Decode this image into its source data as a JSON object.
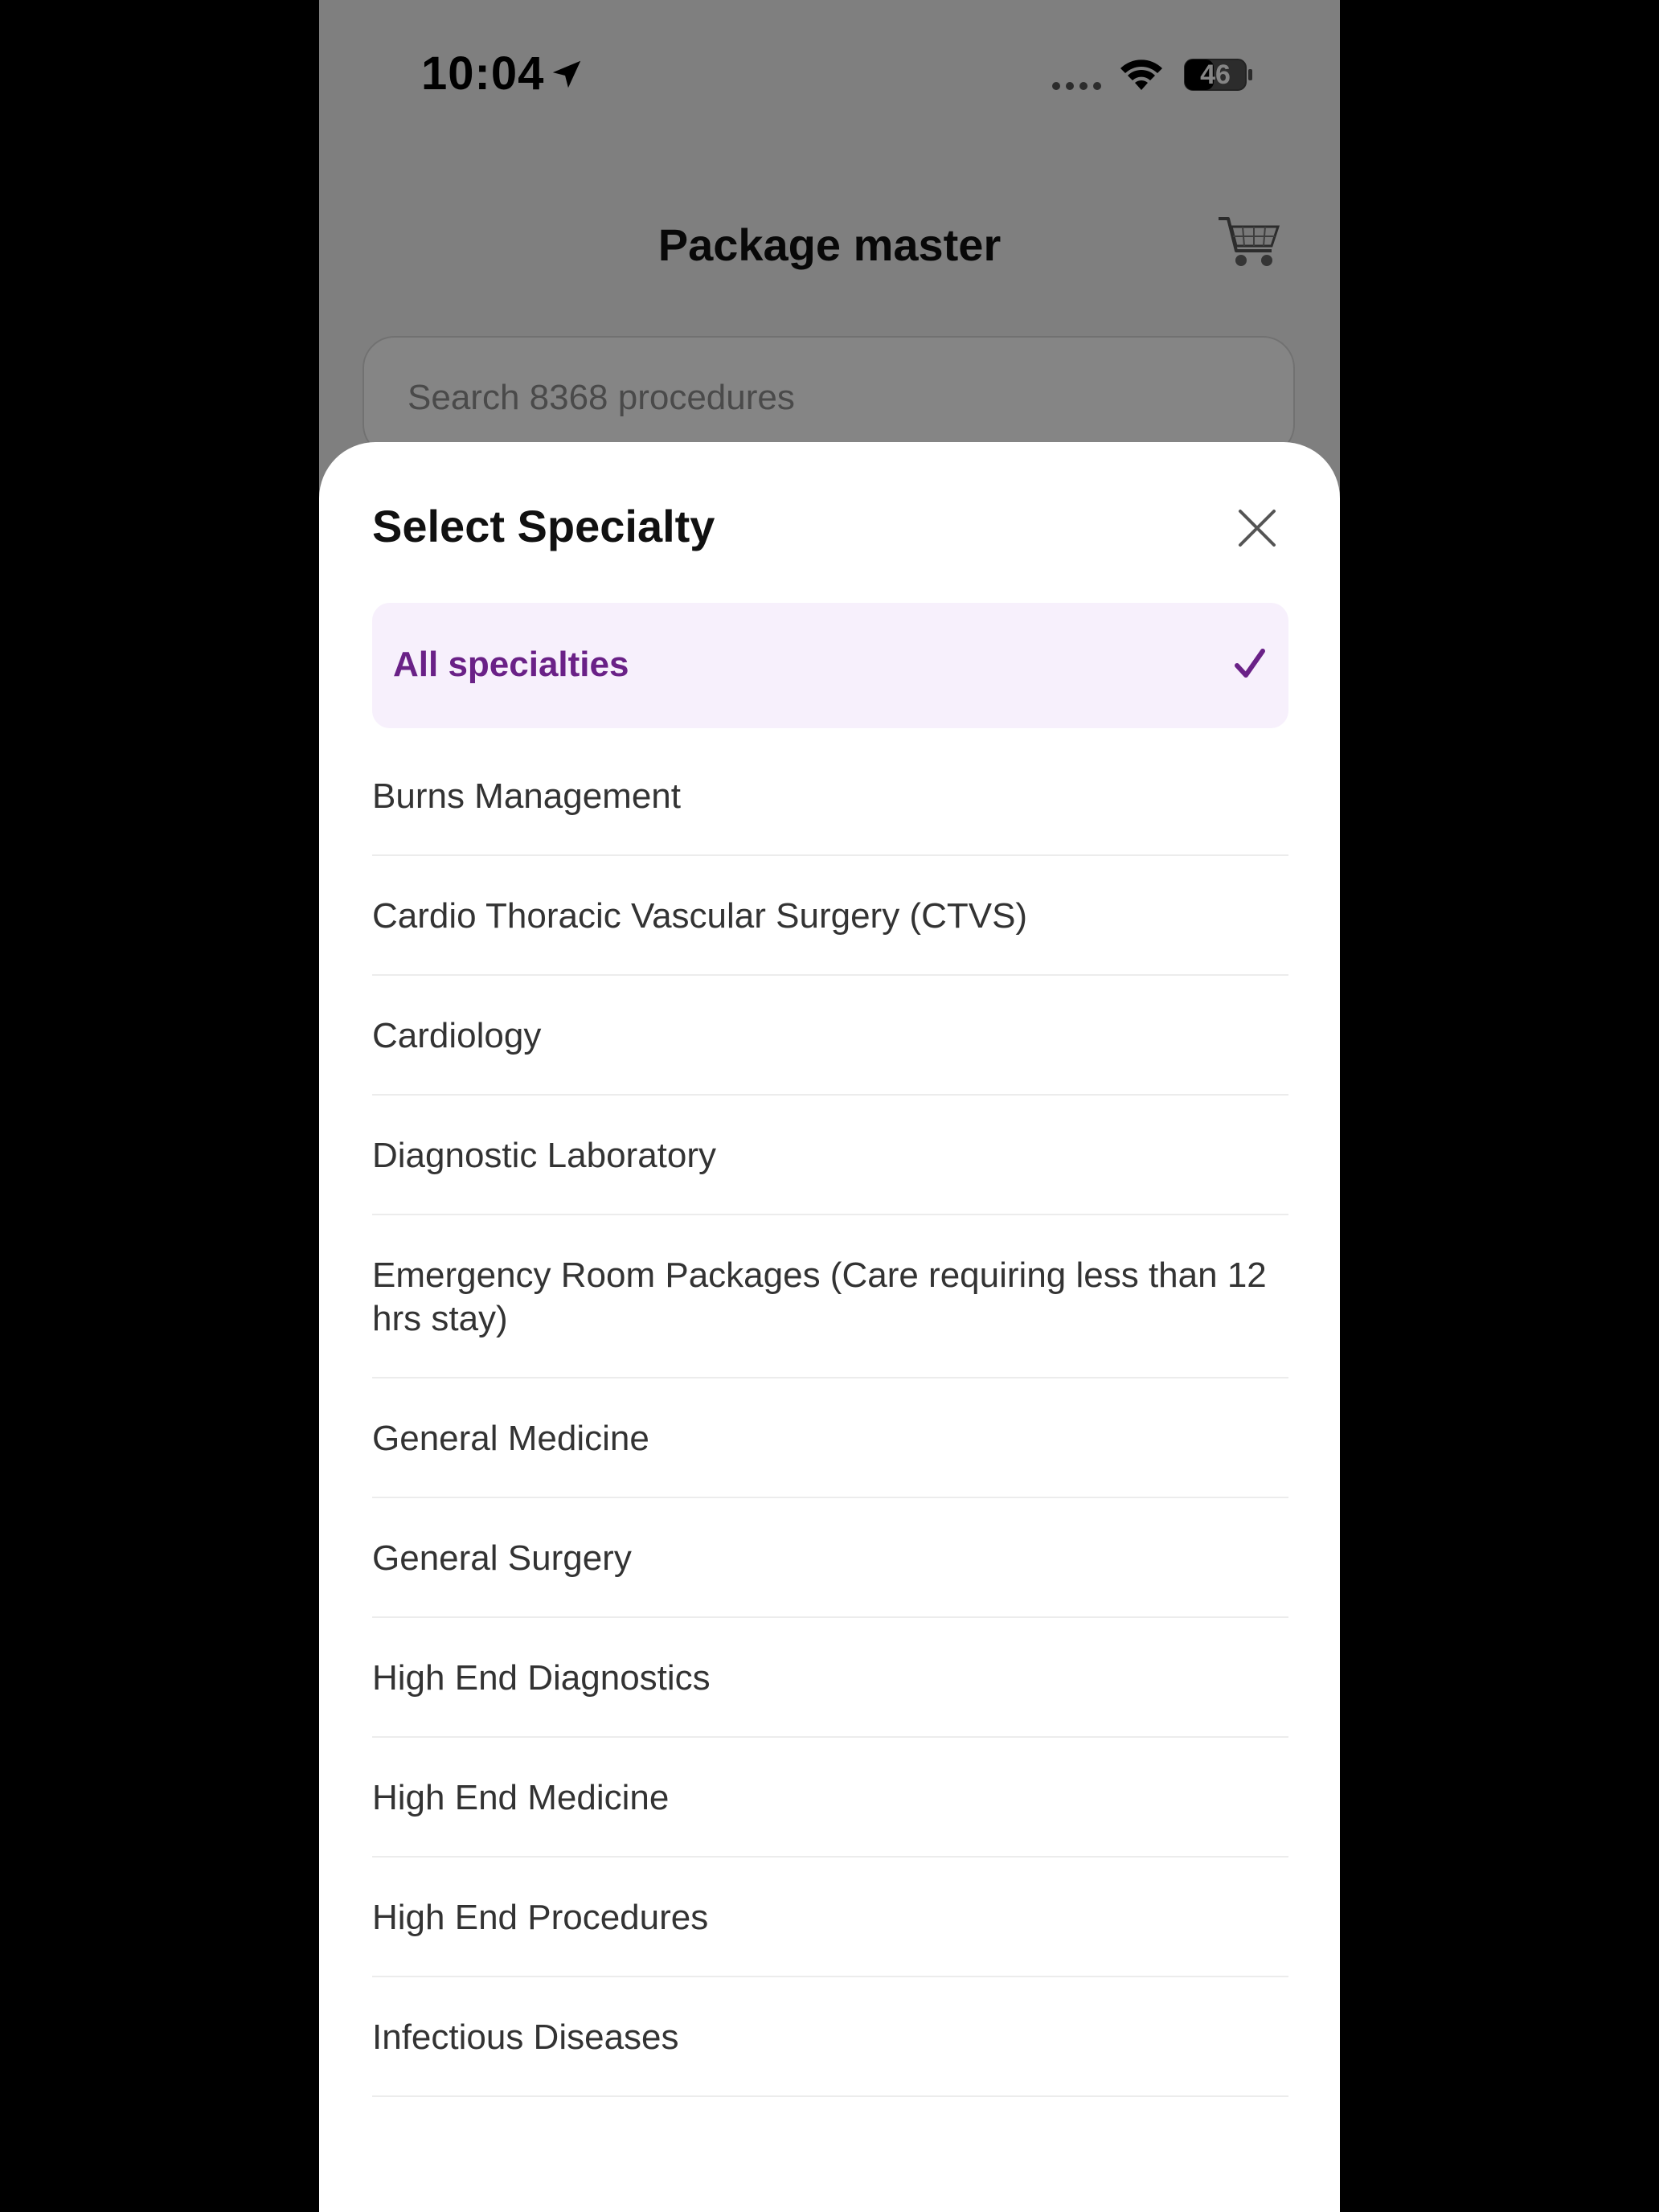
{
  "status_bar": {
    "time": "10:04",
    "battery_level": "46"
  },
  "header": {
    "title": "Package master"
  },
  "search": {
    "placeholder": "Search 8368 procedures"
  },
  "sheet": {
    "title": "Select Specialty",
    "selected_option": "All specialties",
    "options": [
      "Burns Management",
      "Cardio Thoracic Vascular Surgery (CTVS)",
      "Cardiology",
      "Diagnostic Laboratory",
      "Emergency Room Packages (Care requiring less than 12 hrs stay)",
      "General Medicine",
      "General Surgery",
      "High End Diagnostics",
      "High End Medicine",
      "High End Procedures",
      "Infectious Diseases"
    ]
  },
  "colors": {
    "accent": "#6a2187",
    "selected_bg": "#f7f0fc"
  }
}
